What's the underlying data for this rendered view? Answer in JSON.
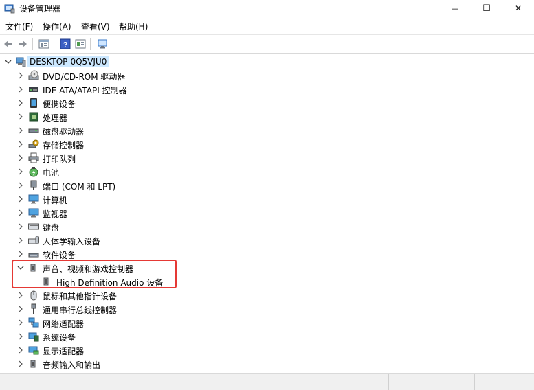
{
  "window": {
    "title": "设备管理器",
    "minimize_glyph": "—",
    "maximize_glyph": "☐",
    "close_glyph": "✕"
  },
  "menu": {
    "items": [
      {
        "label": "文件(F)"
      },
      {
        "label": "操作(A)"
      },
      {
        "label": "查看(V)"
      },
      {
        "label": "帮助(H)"
      }
    ]
  },
  "toolbar": {
    "buttons": [
      {
        "icon": "back-arrow-icon"
      },
      {
        "icon": "forward-arrow-icon"
      },
      {
        "icon": "properties-icon"
      },
      {
        "icon": "help-icon"
      },
      {
        "icon": "update-driver-icon"
      },
      {
        "icon": "scan-hardware-icon"
      }
    ]
  },
  "tree": {
    "root": {
      "label": "DESKTOP-0Q5VJU0",
      "expanded": true,
      "selected": true
    },
    "categories": [
      {
        "label": "DVD/CD-ROM 驱动器",
        "icon": "dvd-drive-icon"
      },
      {
        "label": "IDE ATA/ATAPI 控制器",
        "icon": "ide-controller-icon"
      },
      {
        "label": "便携设备",
        "icon": "portable-device-icon"
      },
      {
        "label": "处理器",
        "icon": "processor-icon"
      },
      {
        "label": "磁盘驱动器",
        "icon": "disk-drive-icon"
      },
      {
        "label": "存储控制器",
        "icon": "storage-controller-icon"
      },
      {
        "label": "打印队列",
        "icon": "printer-icon"
      },
      {
        "label": "电池",
        "icon": "battery-icon"
      },
      {
        "label": "端口 (COM 和 LPT)",
        "icon": "port-icon"
      },
      {
        "label": "计算机",
        "icon": "computer-icon"
      },
      {
        "label": "监视器",
        "icon": "monitor-icon"
      },
      {
        "label": "键盘",
        "icon": "keyboard-icon"
      },
      {
        "label": "人体学输入设备",
        "icon": "hid-icon"
      },
      {
        "label": "软件设备",
        "icon": "software-device-icon"
      },
      {
        "label": "声音、视频和游戏控制器",
        "icon": "speaker-icon",
        "expanded": true,
        "children": [
          {
            "label": "High Definition Audio 设备",
            "icon": "speaker-icon"
          }
        ]
      },
      {
        "label": "鼠标和其他指针设备",
        "icon": "mouse-icon"
      },
      {
        "label": "通用串行总线控制器",
        "icon": "usb-icon"
      },
      {
        "label": "网络适配器",
        "icon": "network-adapter-icon"
      },
      {
        "label": "系统设备",
        "icon": "system-device-icon"
      },
      {
        "label": "显示适配器",
        "icon": "display-adapter-icon"
      },
      {
        "label": "音频输入和输出",
        "icon": "audio-io-icon"
      }
    ]
  },
  "colors": {
    "selection": "#cce8ff",
    "highlight_box": "#e53935"
  }
}
